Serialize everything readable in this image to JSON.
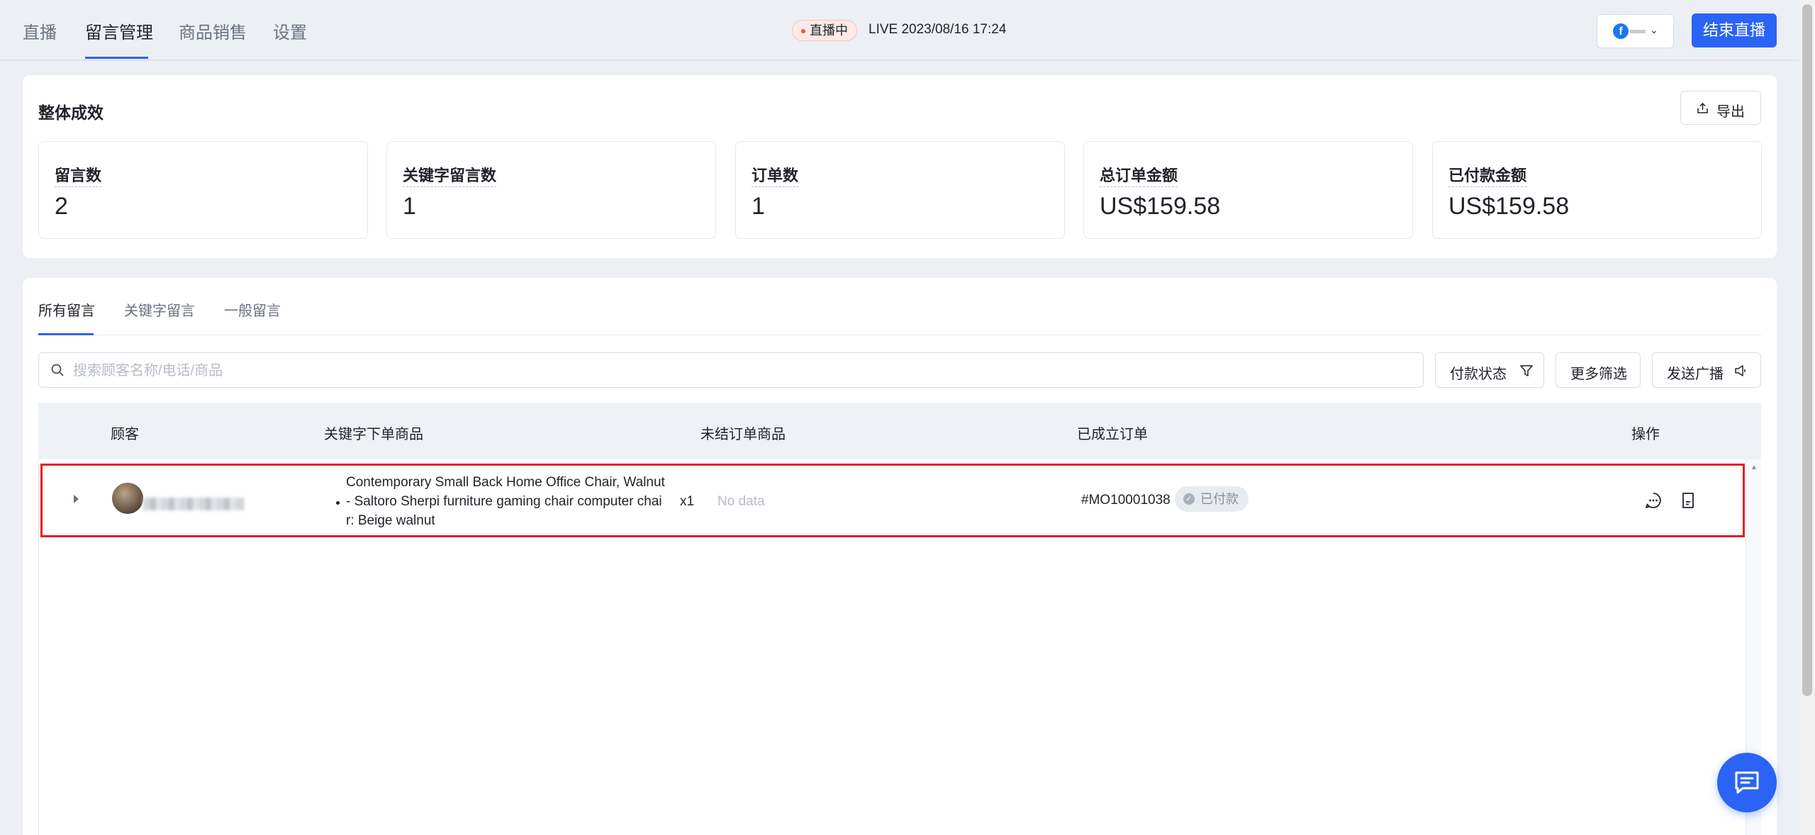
{
  "nav": {
    "tabs": [
      {
        "label": "直播"
      },
      {
        "label": "留言管理"
      },
      {
        "label": "商品销售"
      },
      {
        "label": "设置"
      }
    ],
    "live_status": "直播中",
    "live_time": "LIVE 2023/08/16 17:24",
    "page_selector_icon": "facebook-icon",
    "end_live_label": "结束直播"
  },
  "overview": {
    "title": "整体成效",
    "export_label": "导出",
    "stats": [
      {
        "label": "留言数",
        "value": "2"
      },
      {
        "label": "关键字留言数",
        "value": "1"
      },
      {
        "label": "订单数",
        "value": "1"
      },
      {
        "label": "总订单金额",
        "value": "US$159.58"
      },
      {
        "label": "已付款金额",
        "value": "US$159.58"
      }
    ]
  },
  "comments": {
    "tabs": [
      {
        "label": "所有留言"
      },
      {
        "label": "关键字留言"
      },
      {
        "label": "一般留言"
      }
    ],
    "search_placeholder": "搜索顾客名称/电话/商品",
    "filters": {
      "payment_status": "付款状态",
      "more_filters": "更多筛选",
      "broadcast": "发送广播"
    },
    "columns": {
      "customer": "顾客",
      "keyword_products": "关键字下单商品",
      "pending_products": "未结订单商品",
      "orders": "已成立订单",
      "actions": "操作"
    },
    "rows": [
      {
        "product": "Contemporary Small Back Home Office Chair, Walnut- Saltoro Sherpi furniture gaming chair computer chair: Beige walnut",
        "qty": "x1",
        "pending": "No data",
        "order_id": "#MO10001038",
        "status": "已付款"
      }
    ]
  },
  "colors": {
    "accent": "#2b63f5",
    "highlight_border": "#e51b24",
    "live_dot": "#f0513b"
  }
}
